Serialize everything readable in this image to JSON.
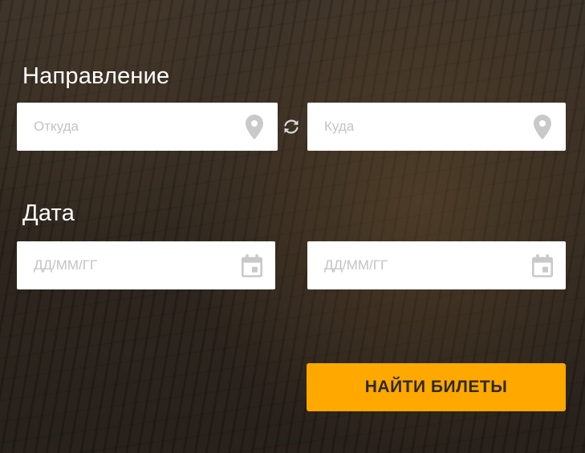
{
  "direction": {
    "title": "Направление",
    "from_placeholder": "Откуда",
    "to_placeholder": "Куда",
    "from_icon": "map-pin-icon",
    "to_icon": "map-pin-icon",
    "swap_icon": "swap-arrows-icon"
  },
  "date": {
    "title": "Дата",
    "date_from_placeholder": "ДД/ММ/ГГ",
    "date_to_placeholder": "ДД/ММ/ГГ",
    "calendar_icon": "calendar-icon"
  },
  "submit": {
    "label": "НАЙТИ БИЛЕТЫ"
  },
  "colors": {
    "accent": "#ffa800",
    "icon_gray": "#c9c9c9",
    "text_white": "#ffffff"
  }
}
